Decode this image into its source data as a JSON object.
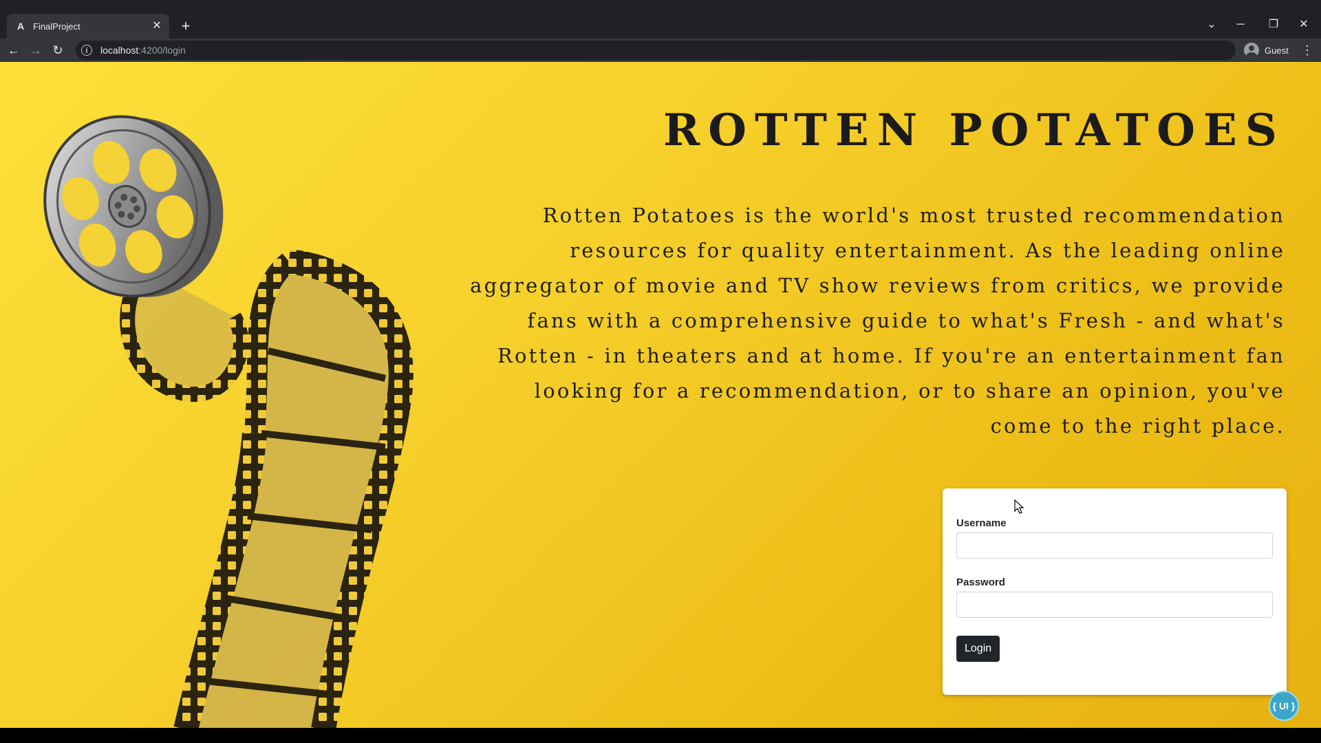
{
  "browser": {
    "tab_title": "FinalProject",
    "tab_favicon": "A",
    "url_host": "localhost",
    "url_path": ":4200/login",
    "profile_name": "Guest",
    "icons": {
      "back": "arrow-left-icon",
      "forward": "arrow-right-icon",
      "reload": "reload-icon",
      "info": "info-icon",
      "menu": "kebab-menu-icon"
    }
  },
  "hero": {
    "brand_title": "Rotten Potatoes",
    "description": "Rotten Potatoes is the world's most trusted recommendation resources for quality entertainment. As the leading online aggregator of movie and TV show reviews from critics, we provide fans with a comprehensive guide to what's Fresh - and what's Rotten - in theaters and at home. If you're an entertainment fan looking for a recommendation, or to share an opinion, you've come to the right place."
  },
  "login_form": {
    "username_label": "Username",
    "username_value": "",
    "password_label": "Password",
    "password_value": "",
    "submit_label": "Login"
  },
  "badge": {
    "label": "{ UI }"
  },
  "colors": {
    "page_bg_start": "#fde03a",
    "page_bg_end": "#e7b111",
    "text_dark": "#1b1b1b",
    "button_bg": "#212529"
  }
}
